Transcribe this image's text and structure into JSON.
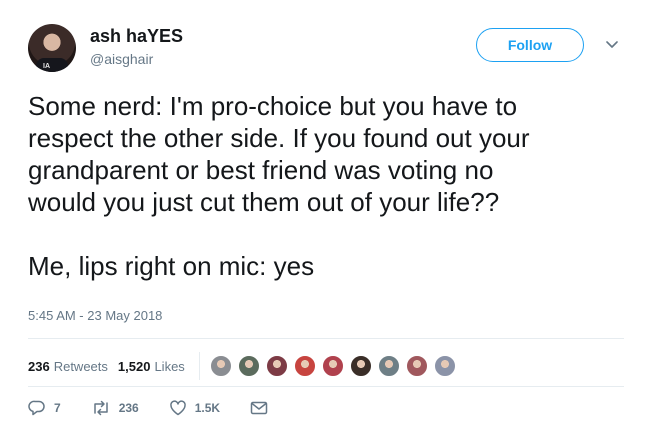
{
  "user": {
    "display_name": "ash haYES",
    "handle": "@aisghair",
    "avatar_icon": "profile-photo"
  },
  "follow_label": "Follow",
  "menu_icon": "chevron-down-icon",
  "tweet": {
    "text": "Some nerd: I'm pro-choice but you have to\nrespect the other side. If you found out your\ngrandparent or best friend was voting no\nwould you just cut them out of your life??\n\nMe, lips right on mic: yes",
    "timestamp": "5:45 AM - 23 May 2018"
  },
  "stats": {
    "retweets_count": "236",
    "retweets_label": "Retweets",
    "likes_count": "1,520",
    "likes_label": "Likes",
    "liker_avatar_colors": [
      "#8a8d92",
      "#5b6b5d",
      "#7d3b45",
      "#c7443f",
      "#b0414d",
      "#3a2e28",
      "#6e7f86",
      "#a0585d",
      "#8b93a8"
    ]
  },
  "actions": {
    "reply_count": "7",
    "retweet_count": "236",
    "like_count": "1.5K"
  },
  "colors": {
    "accent": "#1da1f2",
    "muted": "#657786",
    "text": "#14171a"
  }
}
